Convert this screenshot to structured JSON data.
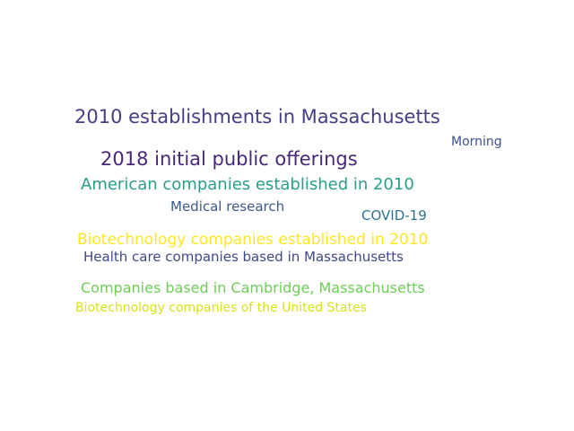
{
  "word_cloud": {
    "words": [
      {
        "text": "2010 establishments in Massachusetts",
        "color": "#433e85"
      },
      {
        "text": "Morning",
        "color": "#3b528b"
      },
      {
        "text": "2018 initial public offerings",
        "color": "#482878"
      },
      {
        "text": "American companies established in 2010",
        "color": "#2a9d8a"
      },
      {
        "text": "Medical research",
        "color": "#3b5a8b"
      },
      {
        "text": "COVID-19",
        "color": "#2c728e"
      },
      {
        "text": "Biotechnology companies established in 2010",
        "color": "#fde725"
      },
      {
        "text": "Health care companies based in Massachusetts",
        "color": "#3e4a89"
      },
      {
        "text": "Companies based in Cambridge, Massachusetts",
        "color": "#6ece58"
      },
      {
        "text": "Biotechnology companies of the United States",
        "color": "#d8e219"
      }
    ]
  }
}
